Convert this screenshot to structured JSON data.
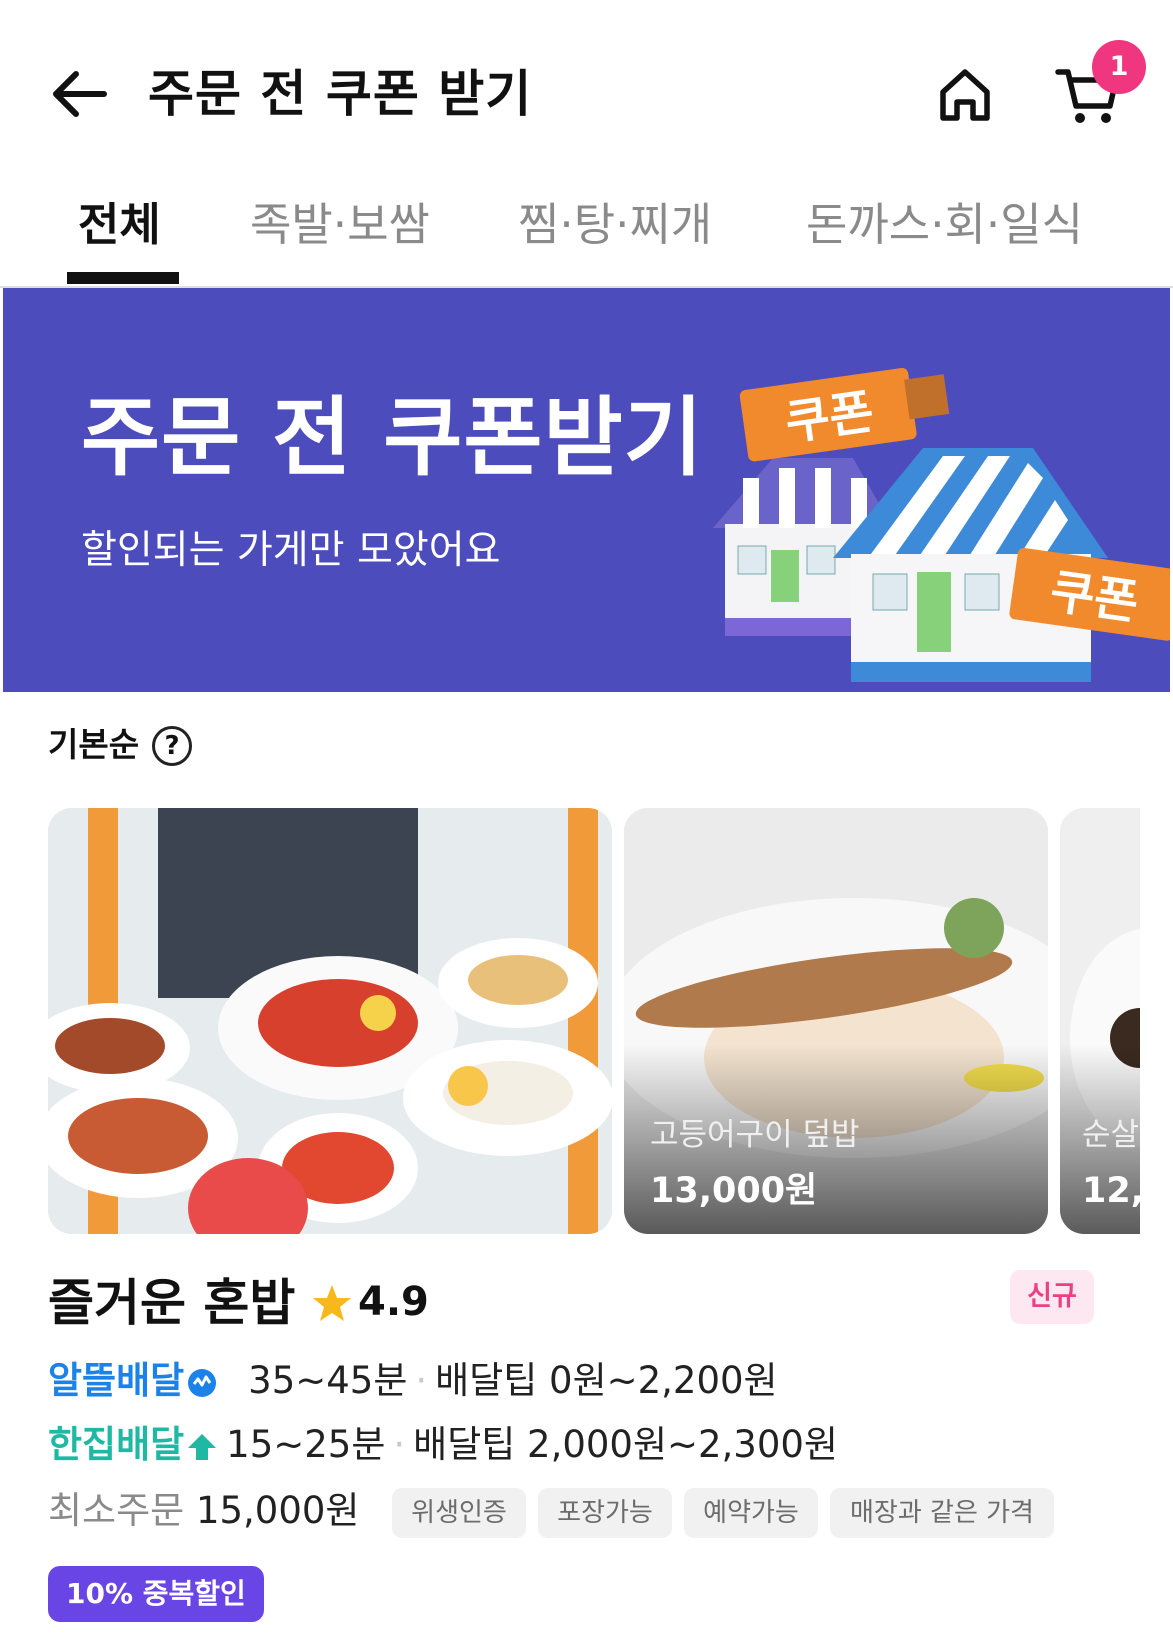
{
  "header": {
    "title": "주문 전 쿠폰 받기",
    "cart_count": "1"
  },
  "tabs": [
    {
      "label": "전체",
      "active": true
    },
    {
      "label": "족발·보쌈",
      "active": false
    },
    {
      "label": "찜·탕·찌개",
      "active": false
    },
    {
      "label": "돈까스·회·일식",
      "active": false
    }
  ],
  "banner": {
    "title": "주문 전 쿠폰받기",
    "subtitle": "할인되는 가게만 모았어요",
    "sign_text_1": "쿠폰",
    "sign_text_2": "쿠폰",
    "bg_color": "#4d4cbd"
  },
  "sort": {
    "label": "기본순",
    "help_symbol": "?"
  },
  "store": {
    "name": "즐거운 혼밥",
    "rating": "4.9",
    "badge": "신규",
    "delivery_rows": [
      {
        "service": "알뜰배달",
        "time": "35~45분",
        "tip": "배달팁 0원~2,200원",
        "color": "#1a82e8"
      },
      {
        "service": "한집배달",
        "time": "15~25분",
        "tip": "배달팁 2,000원~2,300원",
        "color": "#1fb9a3"
      }
    ],
    "min_order_label": "최소주문",
    "min_order_value": "15,000원",
    "tags": [
      "위생인증",
      "포장가능",
      "예약가능",
      "매장과 같은 가격"
    ],
    "promo": "10% 중복할인",
    "images": [
      {
        "name": "고등어구이 덮밥",
        "price": "13,000원"
      },
      {
        "name": "순살",
        "price": "12,"
      }
    ]
  }
}
